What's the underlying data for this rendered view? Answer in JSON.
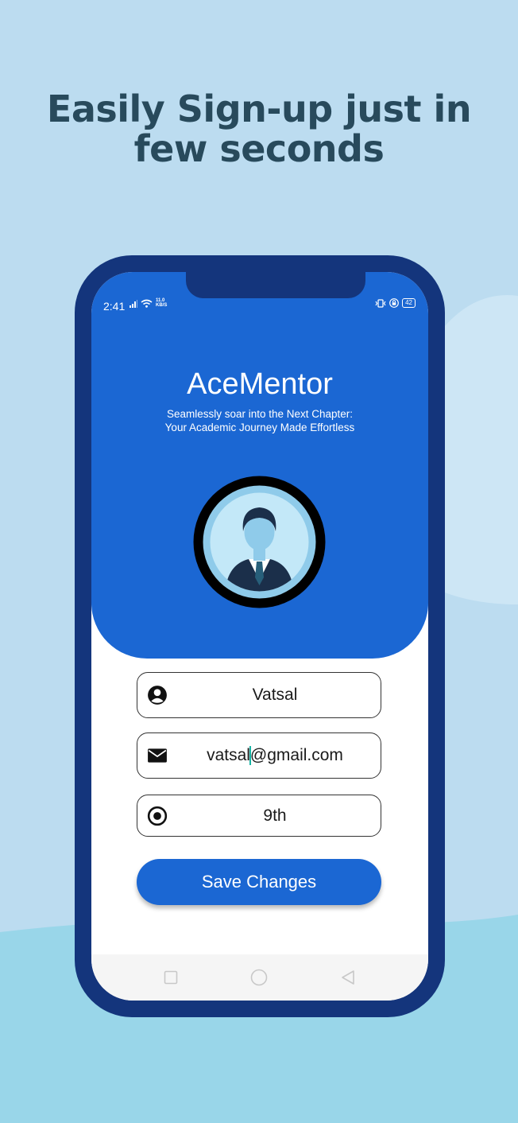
{
  "headline": {
    "line1": "Easily Sign-up just in",
    "line2": "few seconds"
  },
  "status_bar": {
    "time": "2:41",
    "speed_value": "11.0",
    "speed_unit": "KB/S",
    "battery": "42"
  },
  "app": {
    "title": "AceMentor",
    "tagline_line1": "Seamlessly soar into the Next Chapter:",
    "tagline_line2": "Your Academic Journey Made Effortless"
  },
  "form": {
    "name": {
      "value": "Vatsal",
      "icon": "account-circle-icon"
    },
    "email": {
      "value_before_cursor": "vatsal",
      "value_after_cursor": "@gmail.com",
      "icon": "mail-icon"
    },
    "grade": {
      "value": "9th",
      "icon": "radio-target-icon"
    },
    "save_label": "Save Changes"
  },
  "nav": {
    "icons": [
      "square-recents-icon",
      "circle-home-icon",
      "triangle-back-icon"
    ]
  },
  "colors": {
    "background": "#bcdcf0",
    "phone_frame": "#14357c",
    "primary": "#1b67d3",
    "headline": "#284a5c",
    "cursor": "#19b3a4"
  }
}
